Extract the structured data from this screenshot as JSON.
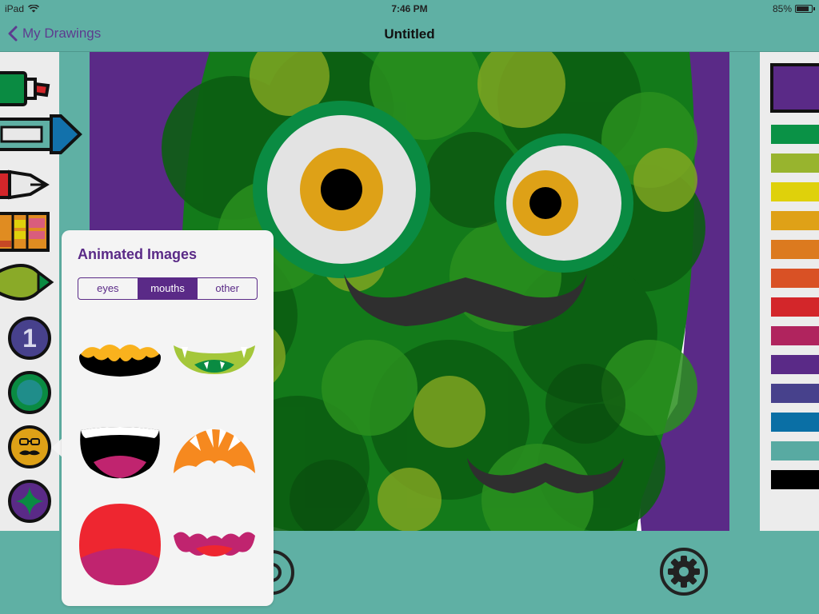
{
  "status": {
    "device": "iPad",
    "time": "7:46 PM",
    "battery": "85%"
  },
  "nav": {
    "back_label": "My Drawings",
    "title": "Untitled"
  },
  "tools": [
    "marker-tool",
    "crayon-tool",
    "pen-tool",
    "stamp-grid-tool",
    "paint-brush-tool",
    "number-stamp-tool",
    "shape-circle-tool",
    "animated-images-tool",
    "sparkle-tool"
  ],
  "palette": {
    "selected": "#5a2a87",
    "swatches": [
      "#0a9246",
      "#98b42e",
      "#dfd10b",
      "#dfa117",
      "#dc7a1f",
      "#d95125",
      "#d3262a",
      "#b0245e",
      "#5a2a87",
      "#47418c",
      "#0a6fa5",
      "#58aaa2",
      "#000000"
    ]
  },
  "popover": {
    "title": "Animated Images",
    "tabs": [
      "eyes",
      "mouths",
      "other"
    ],
    "active_tab": "mouths"
  }
}
